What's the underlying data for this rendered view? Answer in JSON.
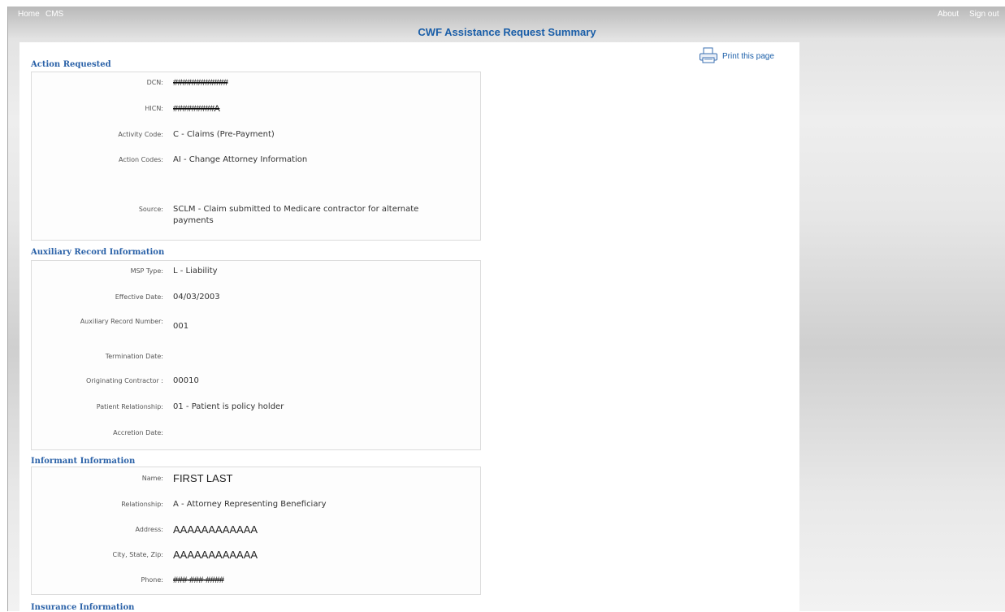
{
  "nav": {
    "home": "Home",
    "cms": "CMS",
    "about": "About",
    "sign_out": "Sign out"
  },
  "page_title": "CWF Assistance Request Summary",
  "print_label": "Print this page",
  "sections": {
    "action": {
      "title": "Action Requested",
      "dcn_label": "DCN:",
      "dcn_value": "############",
      "hicn_label": "HICN:",
      "hicn_value": "#########A",
      "activity_label": "Activity Code:",
      "activity_value": "C - Claims (Pre-Payment)",
      "action_codes_label": "Action Codes:",
      "action_codes_value": "AI - Change Attorney Information",
      "source_label": "Source:",
      "source_value": "SCLM - Claim submitted to Medicare contractor for alternate payments"
    },
    "aux": {
      "title": "Auxiliary Record Information",
      "msp_label": "MSP Type:",
      "msp_value": "L - Liability",
      "eff_label": "Effective Date:",
      "eff_value": "04/03/2003",
      "arn_label": "Auxiliary Record Number:",
      "arn_value": "001",
      "term_label": "Termination Date:",
      "term_value": "",
      "orig_label": "Originating Contractor :",
      "orig_value": "00010",
      "pat_label": "Patient Relationship:",
      "pat_value": "01 - Patient is policy holder",
      "accr_label": "Accretion Date:",
      "accr_value": ""
    },
    "informant": {
      "title": "Informant Information",
      "name_label": "Name:",
      "name_value": "FIRST LAST",
      "rel_label": "Relationship:",
      "rel_value": "A - Attorney Representing Beneficiary",
      "addr_label": "Address:",
      "addr_value": "AAAAAAAAAAAA",
      "csz_label": "City, State, Zip:",
      "csz_value": "AAAAAAAAAAAA",
      "phone_label": "Phone:",
      "phone_value": "###-###-####"
    },
    "insurance": {
      "title": "Insurance Information"
    }
  }
}
